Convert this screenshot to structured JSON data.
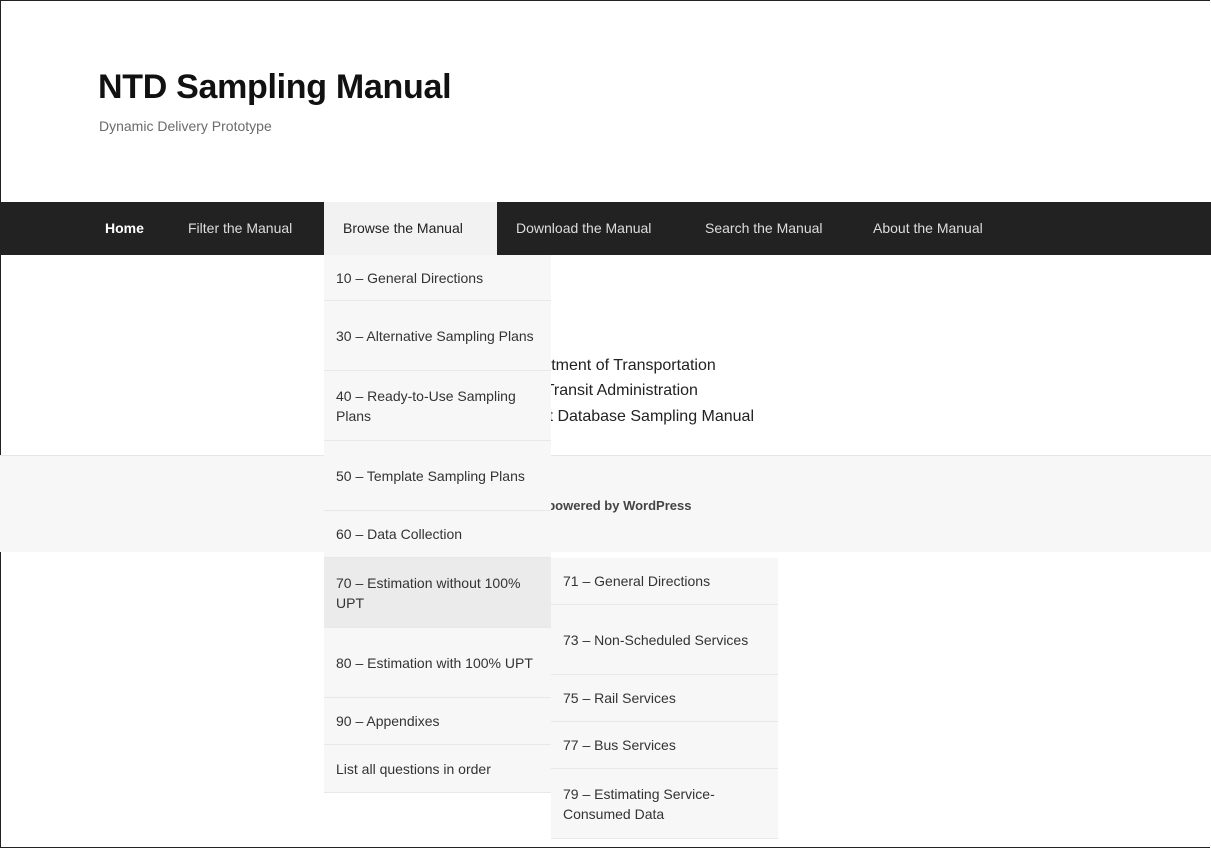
{
  "site": {
    "title": "NTD Sampling Manual",
    "description": "Dynamic Delivery Prototype"
  },
  "nav": {
    "items": [
      {
        "label": "Home"
      },
      {
        "label": "Filter the Manual"
      },
      {
        "label": "Browse the Manual"
      },
      {
        "label": "Download the Manual"
      },
      {
        "label": "Search the Manual"
      },
      {
        "label": "About the Manual"
      }
    ],
    "active": "Browse the Manual"
  },
  "browse_menu": {
    "items": [
      {
        "label": "10 – General Directions"
      },
      {
        "label": "30 – Alternative Sampling Plans"
      },
      {
        "label": "40 – Ready-to-Use Sampling Plans"
      },
      {
        "label": "50 – Template Sampling Plans"
      },
      {
        "label": "60 – Data Collection"
      },
      {
        "label": "70 – Estimation without 100% UPT"
      },
      {
        "label": "80 – Estimation with 100% UPT"
      },
      {
        "label": "90 – Appendixes"
      },
      {
        "label": "List all questions in order"
      }
    ],
    "hovered": "70 – Estimation without 100% UPT"
  },
  "submenu_70": {
    "items": [
      {
        "label": "71 – General Directions"
      },
      {
        "label": "73 – Non-Scheduled Services"
      },
      {
        "label": "75 – Rail Services"
      },
      {
        "label": "77 – Bus Services"
      },
      {
        "label": "79 – Estimating Service-Consumed Data"
      }
    ]
  },
  "content": {
    "lines": [
      "artment of Transportation",
      "l Transit Administration",
      "sit Database Sampling Manual"
    ]
  },
  "footer": {
    "text": "/ powered by WordPress"
  }
}
